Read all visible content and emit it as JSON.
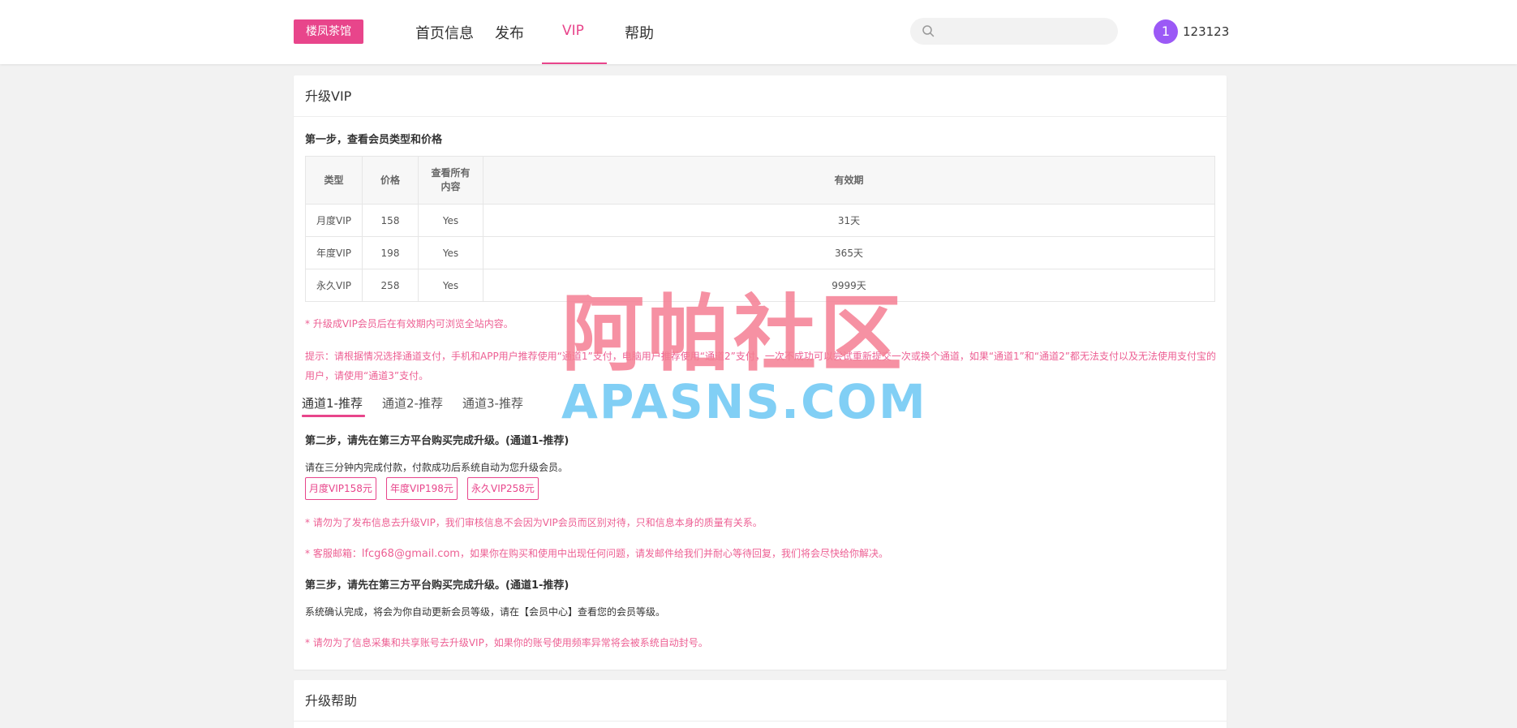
{
  "header": {
    "logo": "楼凤茶馆",
    "nav": [
      {
        "label": "首页信息"
      },
      {
        "label": "发布"
      },
      {
        "label": "VIP"
      },
      {
        "label": "帮助"
      }
    ],
    "search": {
      "placeholder": ""
    },
    "avatar_initial": "1",
    "username": "123123"
  },
  "upgrade": {
    "title": "升级VIP",
    "step1": "第一步，查看会员类型和价格",
    "table": {
      "headers": [
        "类型",
        "价格",
        "查看所有内容",
        "有效期"
      ],
      "rows": [
        [
          "月度VIP",
          "158",
          "Yes",
          "31天"
        ],
        [
          "年度VIP",
          "198",
          "Yes",
          "365天"
        ],
        [
          "永久VIP",
          "258",
          "Yes",
          "9999天"
        ]
      ]
    },
    "note1": "* 升级成VIP会员后在有效期内可浏览全站内容。",
    "tip": "提示：请根据情况选择通道支付，手机和APP用户推荐使用“通道1”支付，电脑用户推荐使用“通道2”支付，一次不成功可以尝试重新提交一次或换个通道，如果“通道1”和“通道2”都无法支付以及无法使用支付宝的用户，请使用“通道3”支付。",
    "tabs": [
      {
        "label": "通道1-推荐"
      },
      {
        "label": "通道2-推荐"
      },
      {
        "label": "通道3-推荐"
      }
    ],
    "step2": "第二步，请先在第三方平台购买完成升级。(通道1-推荐)",
    "step2_desc": "请在三分钟内完成付款，付款成功后系统自动为您升级会员。",
    "buy_buttons": [
      {
        "label": "月度VIP158元"
      },
      {
        "label": "年度VIP198元"
      },
      {
        "label": "永久VIP258元"
      }
    ],
    "note2": "* 请勿为了发布信息去升级VIP，我们审核信息不会因为VIP会员而区别对待，只和信息本身的质量有关系。",
    "note3_prefix": "* 客服邮箱：",
    "email": "lfcg68@gmail.com",
    "note3_suffix": "，如果你在购买和使用中出现任何问题，请发邮件给我们并耐心等待回复，我们将会尽快给你解决。",
    "step3": "第三步，请先在第三方平台购买完成升级。(通道1-推荐)",
    "step3_desc": "系统确认完成，将会为你自动更新会员等级，请在【会员中心】查看您的会员等级。",
    "note4": "* 请勿为了信息采集和共享账号去升级VIP，如果你的账号使用频率异常将会被系统自动封号。"
  },
  "help": {
    "title": "升级帮助"
  },
  "watermark": {
    "line1": "阿帕社区",
    "line2": "APASNS.COM"
  },
  "colors": {
    "accent": "#e8458b",
    "avatar": "#9b59f6",
    "watermark_red": "#f57e93",
    "watermark_blue": "#6cc7f4"
  }
}
